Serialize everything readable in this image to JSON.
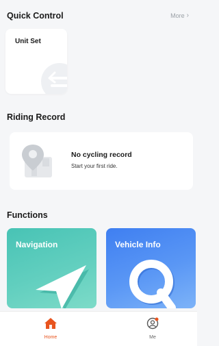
{
  "quick_control": {
    "title": "Quick Control",
    "more_label": "More",
    "unit_set_label": "Unit Set"
  },
  "riding_record": {
    "title": "Riding Record",
    "empty_title": "No cycling record",
    "empty_subtitle": "Start your first ride."
  },
  "functions": {
    "title": "Functions",
    "items": [
      {
        "label": "Navigation",
        "color": "#48c3b5"
      },
      {
        "label": "Vehicle Info",
        "color": "#3f7ff1"
      }
    ]
  },
  "tabbar": {
    "items": [
      {
        "label": "Home",
        "icon": "home-icon",
        "active": true,
        "color": "#e8541e"
      },
      {
        "label": "Me",
        "icon": "user-icon",
        "active": false,
        "badge": true
      }
    ]
  }
}
